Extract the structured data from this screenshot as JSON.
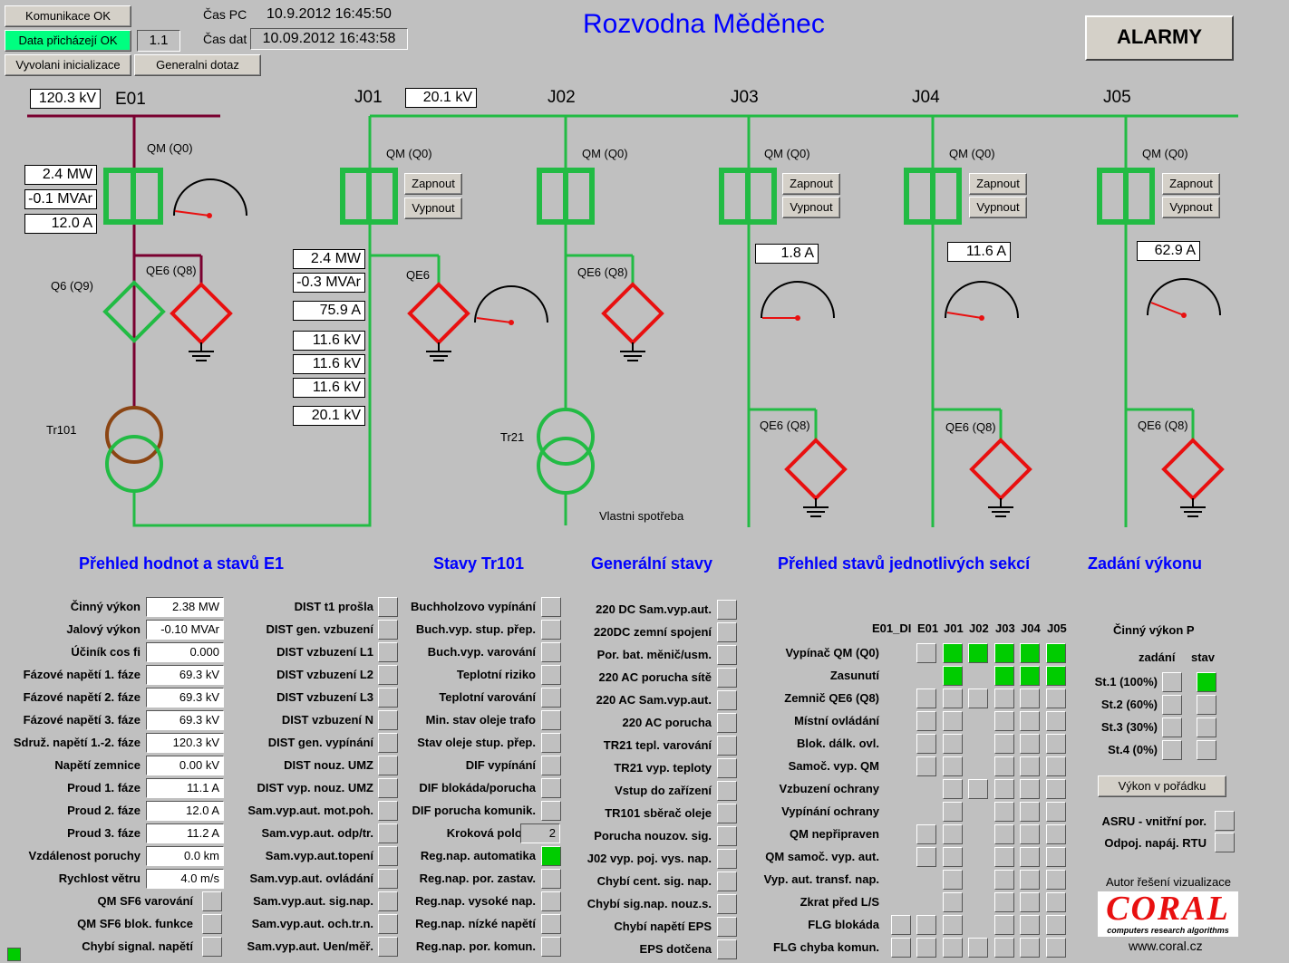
{
  "header": {
    "komunikace": "Komunikace OK",
    "data": "Data přicházejí OK",
    "version": "1.1",
    "inicializace": "Vyvolani inicializace",
    "dotaz": "Generalni dotaz",
    "cas_pc_label": "Čas PC",
    "cas_pc": "10.9.2012 16:45:50",
    "cas_dat_label": "Čas dat",
    "cas_dat": "10.09.2012 16:43:58",
    "title": "Rozvodna Měděnec",
    "alarmy": "ALARMY"
  },
  "scheme": {
    "e01_voltage": "120.3 kV",
    "e01": "E01",
    "j_voltage": "20.1 kV",
    "sections": [
      "J01",
      "J02",
      "J03",
      "J04",
      "J05"
    ],
    "qm": "QM (Q0)",
    "qe6_q8": "QE6 (Q8)",
    "qe6": "QE6",
    "q6": "Q6 (Q9)",
    "tr101": "Tr101",
    "tr21": "Tr21",
    "vlastni": "Vlastni spotřeba",
    "zapnout": "Zapnout",
    "vypnout": "Vypnout",
    "e01_values": [
      "2.4 MW",
      "-0.1 MVAr",
      "12.0 A"
    ],
    "j01_values": [
      "2.4 MW",
      "-0.3 MVAr",
      "75.9 A",
      "11.6 kV",
      "11.6 kV",
      "11.6 kV",
      "20.1 kV"
    ],
    "j03_current": "1.8 A",
    "j04_current": "11.6 A",
    "j05_current": "62.9 A",
    "colors": {
      "green": "#22bb44",
      "red": "#e81010",
      "maroon": "#7a0030",
      "brown": "#8b4513"
    }
  },
  "section_titles": {
    "e1": "Přehled hodnot a stavů E1",
    "tr101": "Stavy Tr101",
    "general": "Generální stavy",
    "sekce": "Přehled stavů jednotlivých sekcí",
    "vykon": "Zadání výkonu"
  },
  "e1_values": [
    {
      "label": "Činný výkon",
      "value": "2.38 MW"
    },
    {
      "label": "Jalový výkon",
      "value": "-0.10 MVAr"
    },
    {
      "label": "Účiník cos fi",
      "value": "0.000"
    },
    {
      "label": "Fázové napětí 1. fáze",
      "value": "69.3 kV"
    },
    {
      "label": "Fázové napětí 2. fáze",
      "value": "69.3 kV"
    },
    {
      "label": "Fázové napětí 3. fáze",
      "value": "69.3 kV"
    },
    {
      "label": "Sdruž. napětí 1.-2. fáze",
      "value": "120.3 kV"
    },
    {
      "label": "Napětí zemnice",
      "value": "0.00 kV"
    },
    {
      "label": "Proud 1. fáze",
      "value": "11.1 A"
    },
    {
      "label": "Proud 2. fáze",
      "value": "12.0 A"
    },
    {
      "label": "Proud 3. fáze",
      "value": "11.2 A"
    },
    {
      "label": "Vzdálenost poruchy",
      "value": "0.0 km"
    },
    {
      "label": "Rychlost větru",
      "value": "4.0 m/s"
    }
  ],
  "e1_leds": [
    "QM SF6 varování",
    "QM SF6 blok. funkce",
    "Chybí signal. napětí"
  ],
  "dist_list": [
    "DIST t1 prošla",
    "DIST gen. vzbuzení",
    "DIST vzbuzení L1",
    "DIST vzbuzení L2",
    "DIST vzbuzení L3",
    "DIST vzbuzení N",
    "DIST gen. vypínání",
    "DIST nouz. UMZ",
    "DIST vyp. nouz. UMZ",
    "Sam.vyp.aut. mot.poh.",
    "Sam.vyp.aut. odp/tr.",
    "Sam.vyp.aut.topení",
    "Sam.vyp.aut. ovládání",
    "Sam.vyp.aut. sig.nap.",
    "Sam.vyp.aut. och.tr.n.",
    "Sam.vyp.aut. Uen/měř."
  ],
  "tr_list": [
    "Buchholzovo vypínání",
    "Buch.vyp. stup. přep.",
    "Buch.vyp. varování",
    "Teplotní riziko",
    "Teplotní varování",
    "Min. stav oleje trafo",
    "Stav oleje stup. přep.",
    "DIF vypínání",
    "DIF blokáda/porucha",
    "DIF porucha komunik.",
    "Kroková poloha",
    "Reg.nap. automatika",
    "Reg.nap. por. zastav.",
    "Reg.nap. vysoké nap.",
    "Reg.nap. nízké napětí",
    "Reg.nap. por. komun."
  ],
  "krokova": "2",
  "gen_list": [
    "220 DC Sam.vyp.aut.",
    "220DC zemní spojení",
    "Por. bat. měnič/usm.",
    "220 AC porucha sítě",
    "220 AC Sam.vyp.aut.",
    "220 AC porucha",
    "TR21 tepl. varování",
    "TR21 vyp. teploty",
    "Vstup do zařízení",
    "TR101 sběrač oleje",
    "Porucha nouzov. sig.",
    "J02 vyp. poj. vys. nap.",
    "Chybí cent. sig. nap.",
    "Chybí sig.nap. nouz.s.",
    "Chybí napětí EPS",
    "EPS dotčena"
  ],
  "sek_headers": [
    "E01_DI",
    "E01",
    "J01",
    "J02",
    "J03",
    "J04",
    "J05"
  ],
  "sek_rows": [
    "Vypínač QM (Q0)",
    "Zasunutí",
    "Zemnič QE6 (Q8)",
    "Místní ovládání",
    "Blok. dálk. ovl.",
    "Samoč. vyp. QM",
    "Vzbuzení ochrany",
    "Vypínání ochrany",
    "QM nepřipraven",
    "QM samoč. vyp. aut.",
    "Vyp. aut. transf. nap.",
    "Zkrat před L/S",
    "FLG blokáda",
    "FLG chyba komun."
  ],
  "vykon": {
    "cinny": "Činný výkon P",
    "zadani": "zadání",
    "stav": "stav",
    "stupne": [
      "St.1 (100%)",
      "St.2 (60%)",
      "St.3 (30%)",
      "St.4 (0%)"
    ],
    "ok": "Výkon v pořádku",
    "asru": "ASRU - vnitřní por.",
    "odpoj": "Odpoj. napáj. RTU",
    "autor": "Autor řešení vizualizace",
    "logo": "CORAL",
    "logo_sub": "computers research algorithms",
    "www": "www.coral.cz"
  }
}
